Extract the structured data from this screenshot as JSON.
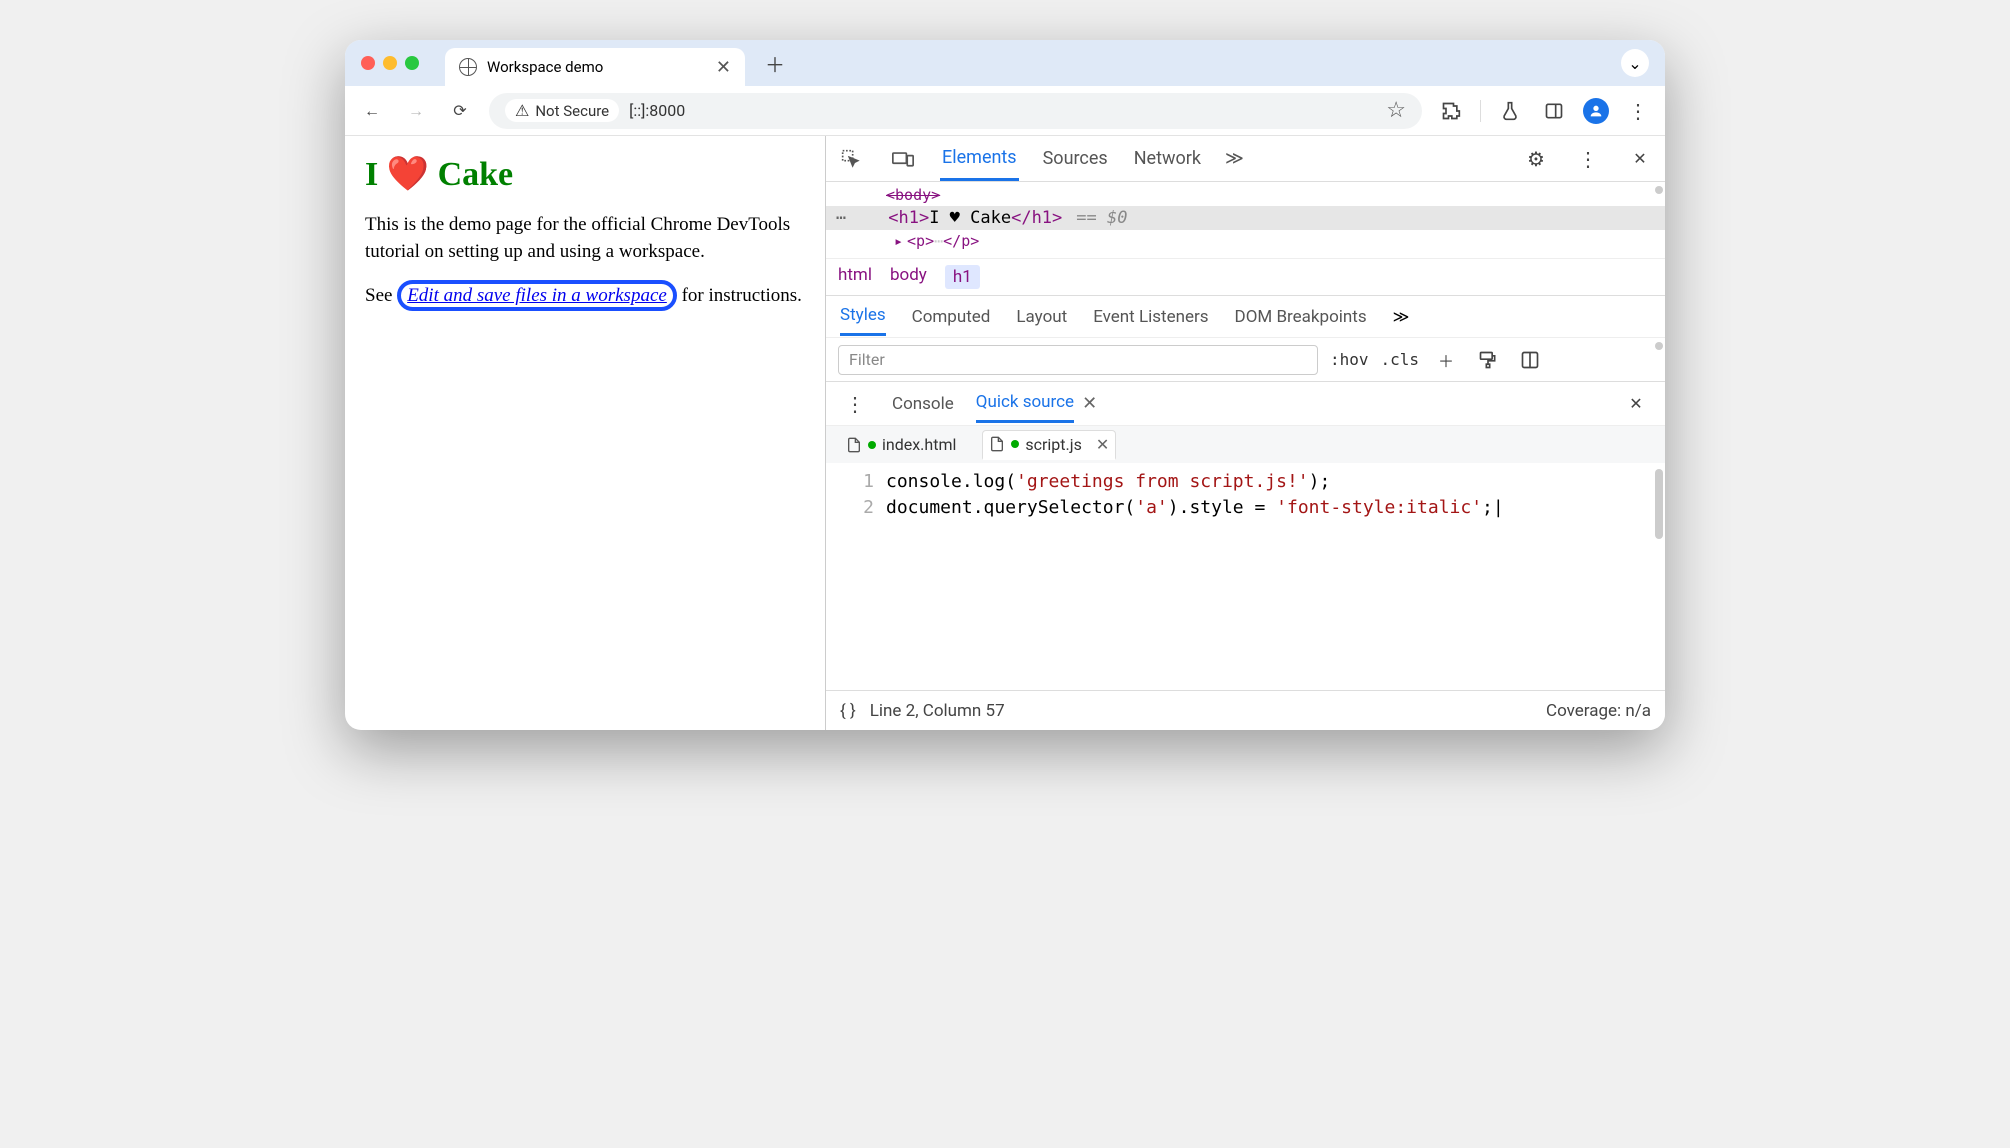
{
  "browser": {
    "tab_title": "Workspace demo",
    "security_label": "Not Secure",
    "url": "[::]:8000"
  },
  "page": {
    "heading": "I ❤️ Cake",
    "para1": "This is the demo page for the official Chrome DevTools tutorial on setting up and using a workspace.",
    "para2_pre": "See ",
    "link_text": "Edit and save files in a workspace",
    "para2_post": " for instructions."
  },
  "devtools": {
    "main_tabs": {
      "elements": "Elements",
      "sources": "Sources",
      "network": "Network"
    },
    "elements": {
      "body_tag_open": "<body>",
      "h1_open": "<h1>",
      "h1_text": "I ♥ Cake",
      "h1_close": "</h1>",
      "eq": "== $0",
      "p_frag": "<p>…</p>"
    },
    "crumbs": {
      "html": "html",
      "body": "body",
      "h1": "h1"
    },
    "styles_tabs": {
      "styles": "Styles",
      "computed": "Computed",
      "layout": "Layout",
      "listeners": "Event Listeners",
      "dom": "DOM Breakpoints"
    },
    "filter_placeholder": "Filter",
    "hov": ":hov",
    "cls": ".cls",
    "drawer": {
      "console": "Console",
      "quick": "Quick source"
    },
    "files": {
      "index": "index.html",
      "script": "script.js"
    },
    "code": {
      "l1": "console.log('greetings from script.js!');",
      "l2": "document.querySelector('a').style = 'font-style:italic';"
    },
    "status": {
      "pos": "Line 2, Column 57",
      "coverage": "Coverage: n/a"
    }
  }
}
